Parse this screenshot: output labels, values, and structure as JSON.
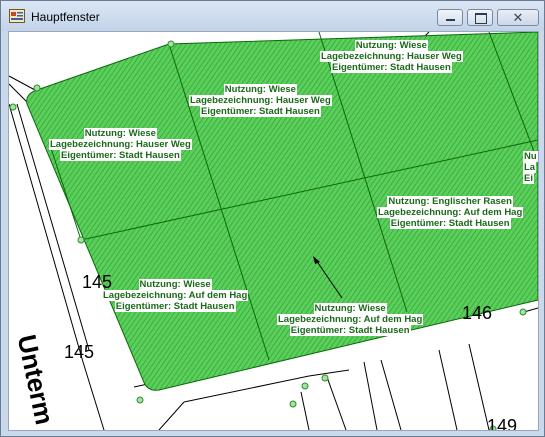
{
  "window": {
    "title": "Hauptfenster",
    "controls": {
      "minimize": "minimize",
      "maximize": "maximize",
      "close": "✕"
    }
  },
  "map": {
    "parcel_labels": [
      {
        "nutzung": "Nutzung: Wiese",
        "lage": "Lagebezeichnung: Hauser Weg",
        "eigentuemer": "Eigentümer: Stadt Hausen"
      },
      {
        "nutzung": "Nutzung: Wiese",
        "lage": "Lagebezeichnung: Hauser Weg",
        "eigentuemer": "Eigentümer: Stadt Hausen"
      },
      {
        "nutzung": "Nutzung: Wiese",
        "lage": "Lagebezeichnung: Hauser Weg",
        "eigentuemer": "Eigentümer: Stadt Hausen"
      },
      {
        "nutzung": "Nutzung: Englischer Rasen",
        "lage": "Lagebezeichnung: Auf dem Hag",
        "eigentuemer": "Eigentümer: Stadt Hausen"
      },
      {
        "nutzung": "Nutzung: Wiese",
        "lage": "Lagebezeichnung: Auf dem Hag",
        "eigentuemer": "Eigentümer: Stadt Hausen"
      },
      {
        "nutzung": "Nutzung: Wiese",
        "lage": "Lagebezeichnung: Auf dem Hag",
        "eigentuemer": "Eigentümer: Stadt Hausen"
      },
      {
        "nutzung": "Nu",
        "lage": "La",
        "eigentuemer": "Ei"
      }
    ],
    "parcel_numbers": [
      "145",
      "145",
      "146",
      "149"
    ],
    "street_name": "Unterm H",
    "colors": {
      "area_fill": "#4fc64f",
      "hatch": "#2f9a2f",
      "boundary": "#0a6a0a",
      "label": "#1a6a1a",
      "vertex": "#7fd87f"
    }
  }
}
